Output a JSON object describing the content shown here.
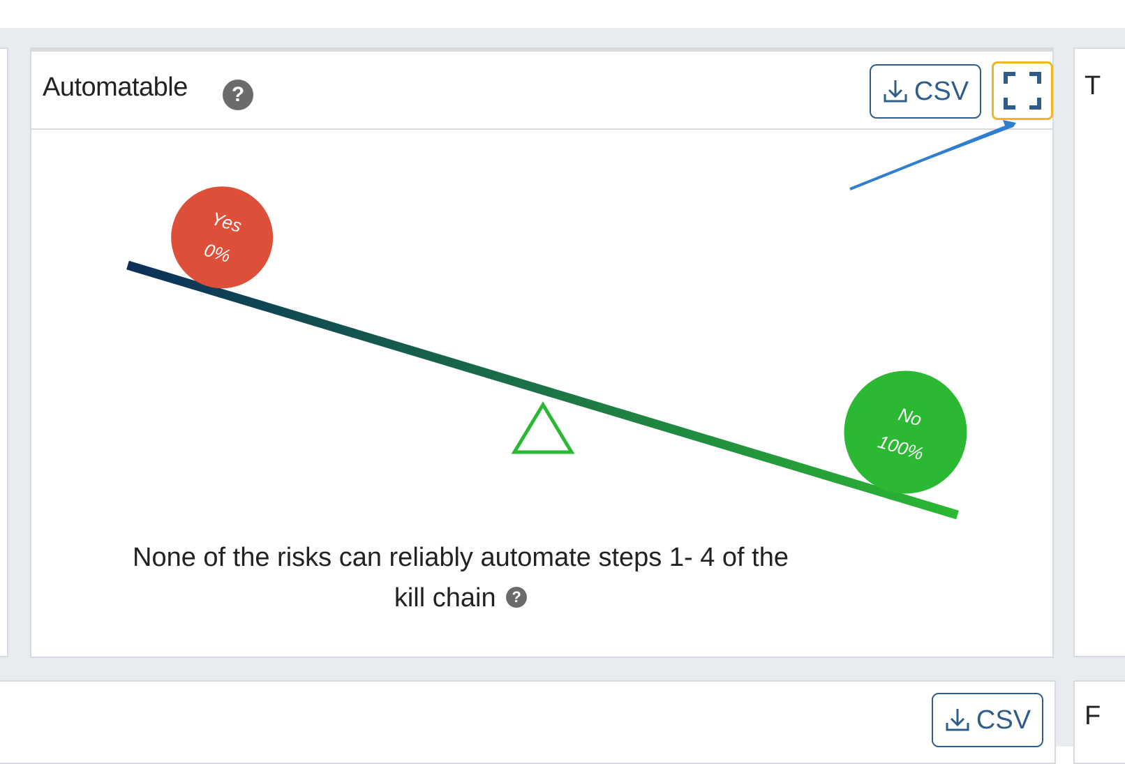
{
  "widget": {
    "title": "Automatable",
    "csv_label": "CSV",
    "caption": "None of the risks can reliably automate steps 1- 4 of the kill chain",
    "help_glyph": "?",
    "icons": {
      "help": "question-circle-icon",
      "download": "download-icon",
      "fullscreen": "expand-icon"
    }
  },
  "chart_data": {
    "type": "seesaw",
    "items": [
      {
        "label": "Yes",
        "value_label": "0%",
        "value": 0,
        "color": "#de4f39"
      },
      {
        "label": "No",
        "value_label": "100%",
        "value": 100,
        "color": "#2bb832"
      }
    ],
    "beam_colors": [
      "#0b2f5a",
      "#2bb832"
    ]
  },
  "neighbors": {
    "right_title_fragment": "T",
    "bottom_csv_label": "CSV",
    "bottom_right_fragment": "F"
  },
  "annotation": {
    "highlight_color": "#f0b722",
    "arrow_color": "#2f7fd0"
  }
}
